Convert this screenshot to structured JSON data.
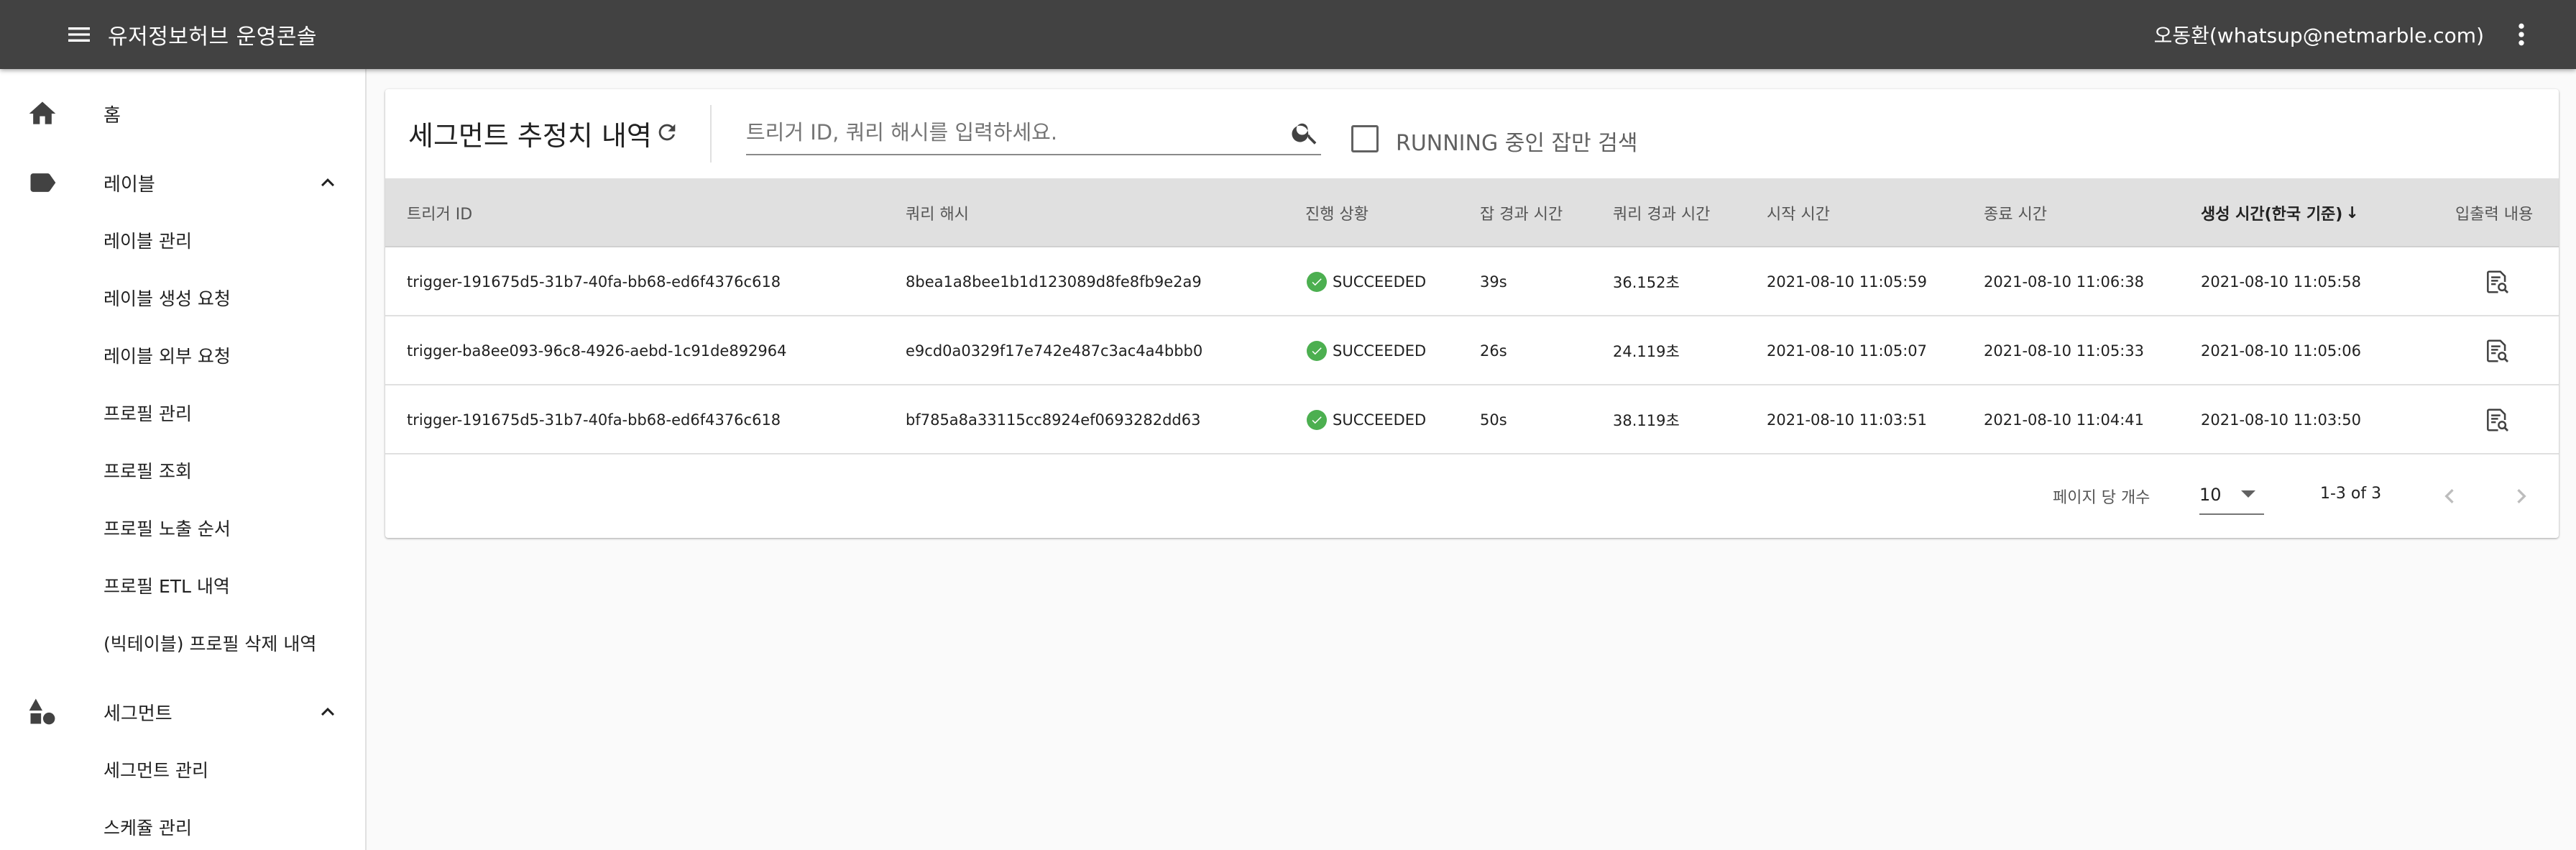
{
  "app": {
    "title": "유저정보허브 운영콘솔",
    "user": "오동환(whatsup@netmarble.com)"
  },
  "icons": {
    "menu": "menu-icon",
    "more": "more-vert-icon",
    "home": "home-icon",
    "label": "label-tag-icon",
    "segment": "shapes-icon",
    "expand": "chevron-up-icon",
    "refresh": "refresh-icon",
    "search": "search-icon",
    "success": "check-circle-icon",
    "io": "document-search-icon",
    "prev": "chevron-left-icon",
    "next": "chevron-right-icon",
    "sort": "arrow-down-icon"
  },
  "colors": {
    "appbar": "#424242",
    "success": "#4caf50",
    "header_row": "#e0e0e0"
  },
  "sidebar": {
    "home": "홈",
    "label_group": "레이블",
    "label_items": [
      "레이블 관리",
      "레이블 생성 요청",
      "레이블 외부 요청",
      "프로필 관리",
      "프로필 조회",
      "프로필 노출 순서",
      "프로필 ETL 내역",
      "(빅테이블) 프로필 삭제 내역"
    ],
    "segment_group": "세그먼트",
    "segment_items": [
      "세그먼트 관리",
      "스케쥴 관리"
    ]
  },
  "main": {
    "title": "세그먼트 추정치 내역",
    "search": {
      "placeholder": "트리거 ID, 쿼리 해시를 입력하세요.",
      "value": ""
    },
    "running_only": {
      "label": "RUNNING 중인 잡만 검색",
      "checked": false
    },
    "columns": [
      "트리거 ID",
      "쿼리 해시",
      "진행 상황",
      "잡 경과 시간",
      "쿼리 경과 시간",
      "시작 시간",
      "종료 시간",
      "생성 시간(한국 기준)",
      "입출력 내용"
    ],
    "sort_arrow": "↓",
    "rows": [
      {
        "trigger_id": "trigger-191675d5-31b7-40fa-bb68-ed6f4376c618",
        "query_hash": "8bea1a8bee1b1d123089d8fe8fb9e2a9",
        "status": "SUCCEEDED",
        "job_elapsed": "39s",
        "query_elapsed": "36.152초",
        "start": "2021-08-10 11:05:59",
        "end": "2021-08-10 11:06:38",
        "created": "2021-08-10 11:05:58"
      },
      {
        "trigger_id": "trigger-ba8ee093-96c8-4926-aebd-1c91de892964",
        "query_hash": "e9cd0a0329f17e742e487c3ac4a4bbb0",
        "status": "SUCCEEDED",
        "job_elapsed": "26s",
        "query_elapsed": "24.119초",
        "start": "2021-08-10 11:05:07",
        "end": "2021-08-10 11:05:33",
        "created": "2021-08-10 11:05:06"
      },
      {
        "trigger_id": "trigger-191675d5-31b7-40fa-bb68-ed6f4376c618",
        "query_hash": "bf785a8a33115cc8924ef0693282dd63",
        "status": "SUCCEEDED",
        "job_elapsed": "50s",
        "query_elapsed": "38.119초",
        "start": "2021-08-10 11:03:51",
        "end": "2021-08-10 11:04:41",
        "created": "2021-08-10 11:03:50"
      }
    ],
    "pagination": {
      "rows_per_page_label": "페이지 당 개수",
      "rows_per_page": "10",
      "range": "1-3 of 3"
    }
  }
}
